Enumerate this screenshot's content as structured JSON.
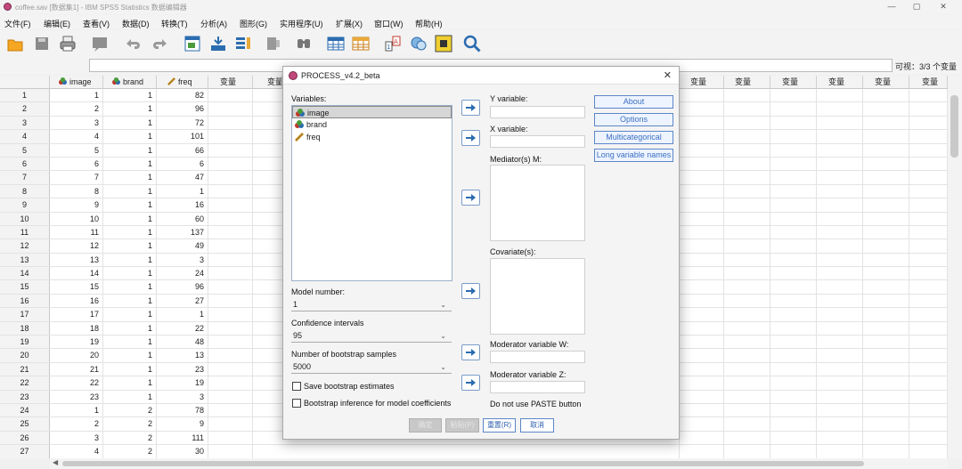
{
  "window": {
    "title": "coffee.sav [数据集1] - IBM SPSS Statistics 数据编辑器",
    "controls": {
      "minimize": "—",
      "maximize": "▢",
      "close": "✕"
    }
  },
  "menubar": [
    "文件(F)",
    "编辑(E)",
    "查看(V)",
    "数据(D)",
    "转换(T)",
    "分析(A)",
    "图形(G)",
    "实用程序(U)",
    "扩展(X)",
    "窗口(W)",
    "帮助(H)"
  ],
  "toolbar_icons": [
    "open-icon",
    "save-icon",
    "print-icon",
    "recall-dialog-icon",
    "undo-icon",
    "redo-icon",
    "goto-case-icon",
    "goto-variable-icon",
    "variables-icon",
    "run-descriptives-icon",
    "find-icon",
    "insert-cases-icon",
    "insert-variable-icon",
    "split-file-icon",
    "weight-cases-icon",
    "select-cases-icon",
    "value-labels-icon",
    "search-icon"
  ],
  "refbar": {
    "value": "",
    "visible_label": "可视：3/3 个变量"
  },
  "grid": {
    "columns": [
      {
        "name": "image",
        "type": "nominal"
      },
      {
        "name": "brand",
        "type": "nominal"
      },
      {
        "name": "freq",
        "type": "scale"
      }
    ],
    "empty_column_label": "变量",
    "rows": [
      {
        "n": "1",
        "image": "1",
        "brand": "1",
        "freq": "82"
      },
      {
        "n": "2",
        "image": "2",
        "brand": "1",
        "freq": "96"
      },
      {
        "n": "3",
        "image": "3",
        "brand": "1",
        "freq": "72"
      },
      {
        "n": "4",
        "image": "4",
        "brand": "1",
        "freq": "101"
      },
      {
        "n": "5",
        "image": "5",
        "brand": "1",
        "freq": "66"
      },
      {
        "n": "6",
        "image": "6",
        "brand": "1",
        "freq": "6"
      },
      {
        "n": "7",
        "image": "7",
        "brand": "1",
        "freq": "47"
      },
      {
        "n": "8",
        "image": "8",
        "brand": "1",
        "freq": "1"
      },
      {
        "n": "9",
        "image": "9",
        "brand": "1",
        "freq": "16"
      },
      {
        "n": "10",
        "image": "10",
        "brand": "1",
        "freq": "60"
      },
      {
        "n": "11",
        "image": "11",
        "brand": "1",
        "freq": "137"
      },
      {
        "n": "12",
        "image": "12",
        "brand": "1",
        "freq": "49"
      },
      {
        "n": "13",
        "image": "13",
        "brand": "1",
        "freq": "3"
      },
      {
        "n": "14",
        "image": "14",
        "brand": "1",
        "freq": "24"
      },
      {
        "n": "15",
        "image": "15",
        "brand": "1",
        "freq": "96"
      },
      {
        "n": "16",
        "image": "16",
        "brand": "1",
        "freq": "27"
      },
      {
        "n": "17",
        "image": "17",
        "brand": "1",
        "freq": "1"
      },
      {
        "n": "18",
        "image": "18",
        "brand": "1",
        "freq": "22"
      },
      {
        "n": "19",
        "image": "19",
        "brand": "1",
        "freq": "48"
      },
      {
        "n": "20",
        "image": "20",
        "brand": "1",
        "freq": "13"
      },
      {
        "n": "21",
        "image": "21",
        "brand": "1",
        "freq": "23"
      },
      {
        "n": "22",
        "image": "22",
        "brand": "1",
        "freq": "19"
      },
      {
        "n": "23",
        "image": "23",
        "brand": "1",
        "freq": "3"
      },
      {
        "n": "24",
        "image": "1",
        "brand": "2",
        "freq": "78"
      },
      {
        "n": "25",
        "image": "2",
        "brand": "2",
        "freq": "9"
      },
      {
        "n": "26",
        "image": "3",
        "brand": "2",
        "freq": "111"
      },
      {
        "n": "27",
        "image": "4",
        "brand": "2",
        "freq": "30"
      }
    ]
  },
  "dialog": {
    "title": "PROCESS_v4.2_beta",
    "close": "✕",
    "variables_label": "Variables:",
    "variables": [
      {
        "name": "image",
        "type": "nominal",
        "selected": true
      },
      {
        "name": "brand",
        "type": "nominal",
        "selected": false
      },
      {
        "name": "freq",
        "type": "scale",
        "selected": false
      }
    ],
    "y_label": "Y variable:",
    "x_label": "X variable:",
    "mediator_label": "Mediator(s) M:",
    "covariate_label": "Covariate(s):",
    "mod_w_label": "Moderator variable W:",
    "mod_z_label": "Moderator variable Z:",
    "paste_note": "Do not use PASTE button",
    "model_number_label": "Model number:",
    "model_number": "1",
    "ci_label": "Confidence intervals",
    "ci": "95",
    "bootstrap_label": "Number of bootstrap samples",
    "bootstrap": "5000",
    "save_bootstrap": "Save bootstrap estimates",
    "bootstrap_inference": "Bootstrap inference for model coefficients",
    "side_buttons": [
      "About",
      "Options",
      "Multicategorical",
      "Long variable names"
    ],
    "buttons": {
      "ok": "确定",
      "paste": "粘贴(P)",
      "reset": "重置(R)",
      "cancel": "取消"
    }
  },
  "colors": {
    "accent": "#3a6fc2",
    "selection": "#d6d6d6",
    "disabled": "#c8c8c8"
  }
}
